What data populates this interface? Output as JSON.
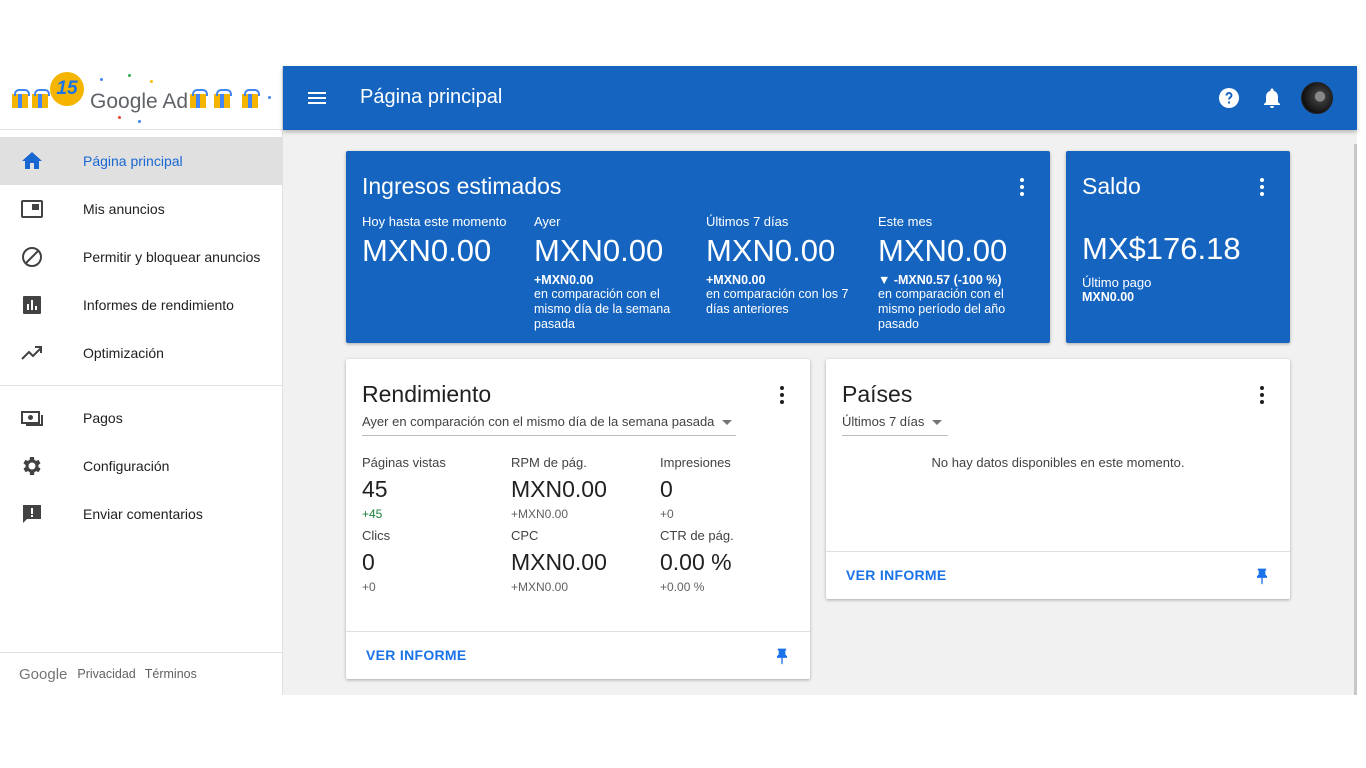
{
  "logo": {
    "badge": "15",
    "brand": "Google Ad"
  },
  "header": {
    "title": "Página principal"
  },
  "sidebar": {
    "items": [
      {
        "label": "Página principal",
        "icon": "home-icon",
        "active": true
      },
      {
        "label": "Mis anuncios",
        "icon": "ad-unit-icon"
      },
      {
        "label": "Permitir y bloquear anuncios",
        "icon": "block-icon"
      },
      {
        "label": "Informes de rendimiento",
        "icon": "bar-chart-icon"
      },
      {
        "label": "Optimización",
        "icon": "trending-up-icon"
      },
      {
        "label": "Pagos",
        "icon": "money-icon"
      },
      {
        "label": "Configuración",
        "icon": "gear-icon"
      },
      {
        "label": "Enviar comentarios",
        "icon": "feedback-icon"
      }
    ],
    "footer": {
      "google": "Google",
      "privacy": "Privacidad",
      "terms": "Términos"
    }
  },
  "earnings": {
    "title": "Ingresos estimados",
    "metrics": [
      {
        "label": "Hoy hasta este momento",
        "value": "MXN0.00",
        "delta": "",
        "comparison": ""
      },
      {
        "label": "Ayer",
        "value": "MXN0.00",
        "delta": "+MXN0.00",
        "comparison": "en comparación con el mismo día de la semana pasada"
      },
      {
        "label": "Últimos 7 días",
        "value": "MXN0.00",
        "delta": "+MXN0.00",
        "comparison": "en comparación con los 7 días anteriores"
      },
      {
        "label": "Este mes",
        "value": "MXN0.00",
        "delta": "▼ -MXN0.57 (-100 %)",
        "comparison": "en comparación con el mismo período del año pasado"
      }
    ]
  },
  "balance": {
    "title": "Saldo",
    "value": "MX$176.18",
    "last_payment_label": "Último pago",
    "last_payment_value": "MXN0.00"
  },
  "performance": {
    "title": "Rendimiento",
    "range": "Ayer en comparación con el mismo día de la semana pasada",
    "stats": [
      {
        "label": "Páginas vistas",
        "value": "45",
        "delta": "+45"
      },
      {
        "label": "RPM de pág.",
        "value": "MXN0.00",
        "delta": "+MXN0.00"
      },
      {
        "label": "Impresiones",
        "value": "0",
        "delta": "+0"
      },
      {
        "label": "Clics",
        "value": "0",
        "delta": "+0"
      },
      {
        "label": "CPC",
        "value": "MXN0.00",
        "delta": "+MXN0.00"
      },
      {
        "label": "CTR de pág.",
        "value": "0.00 %",
        "delta": "+0.00 %"
      }
    ],
    "report_link": "VER INFORME"
  },
  "countries": {
    "title": "Países",
    "range": "Últimos 7 días",
    "empty": "No hay datos disponibles en este momento.",
    "report_link": "VER INFORME"
  },
  "colors": {
    "primary": "#1565c0",
    "link": "#1a73e8",
    "positive": "#188038"
  }
}
